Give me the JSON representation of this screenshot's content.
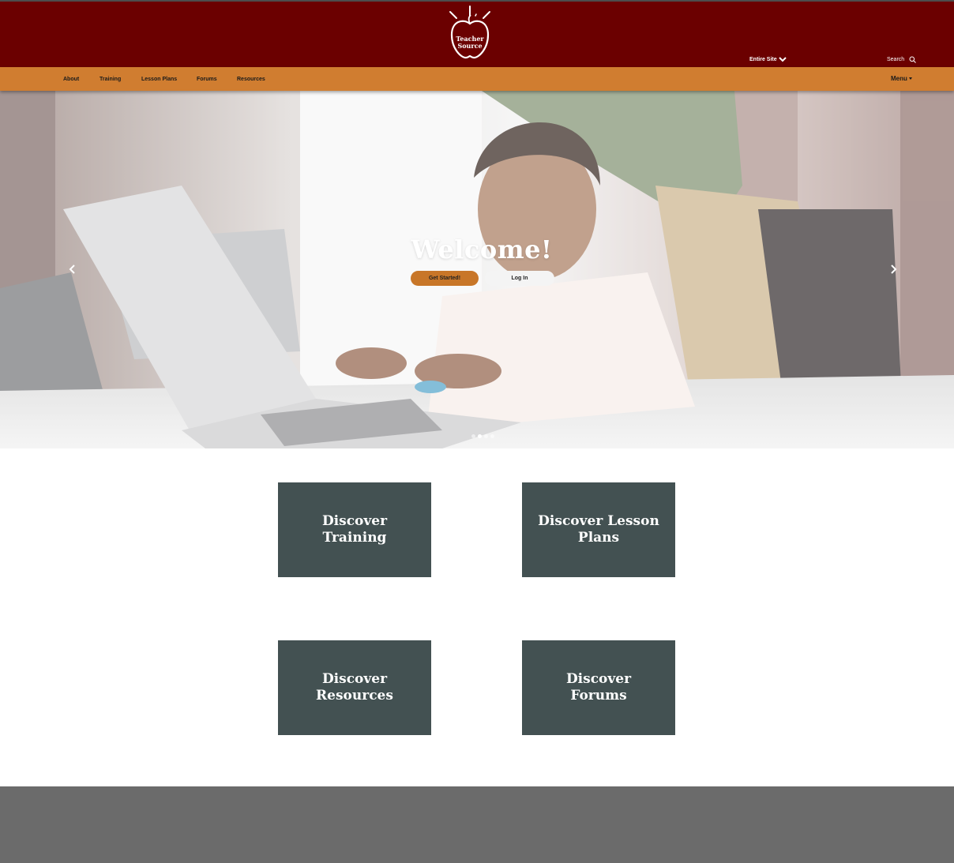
{
  "header": {
    "logo_line1": "Teacher",
    "logo_line2": "Source",
    "search_scope": "Entire Site",
    "search_label": "Search"
  },
  "nav": {
    "links": [
      "About",
      "Training",
      "Lesson Plans",
      "Forums",
      "Resources"
    ],
    "menu_label": "Menu"
  },
  "hero": {
    "title": "Welcome!",
    "primary_button": "Get Started!",
    "secondary_button": "Log In",
    "slide_count": 4,
    "active_slide": 2
  },
  "cards": [
    "Discover Training",
    "Discover Lesson Plans",
    "Discover Resources",
    "Discover Forums"
  ],
  "colors": {
    "header_bg": "#6b0000",
    "nav_bg": "#d07d30",
    "button_accent": "#c87628",
    "card_bg": "#435152",
    "footer_bg": "#6b6b6b"
  },
  "icons": {
    "logo": "apple-logo-icon",
    "scope_chevron": "chevron-down-icon",
    "search": "search-icon",
    "prev": "chevron-left-icon",
    "next": "chevron-right-icon"
  }
}
